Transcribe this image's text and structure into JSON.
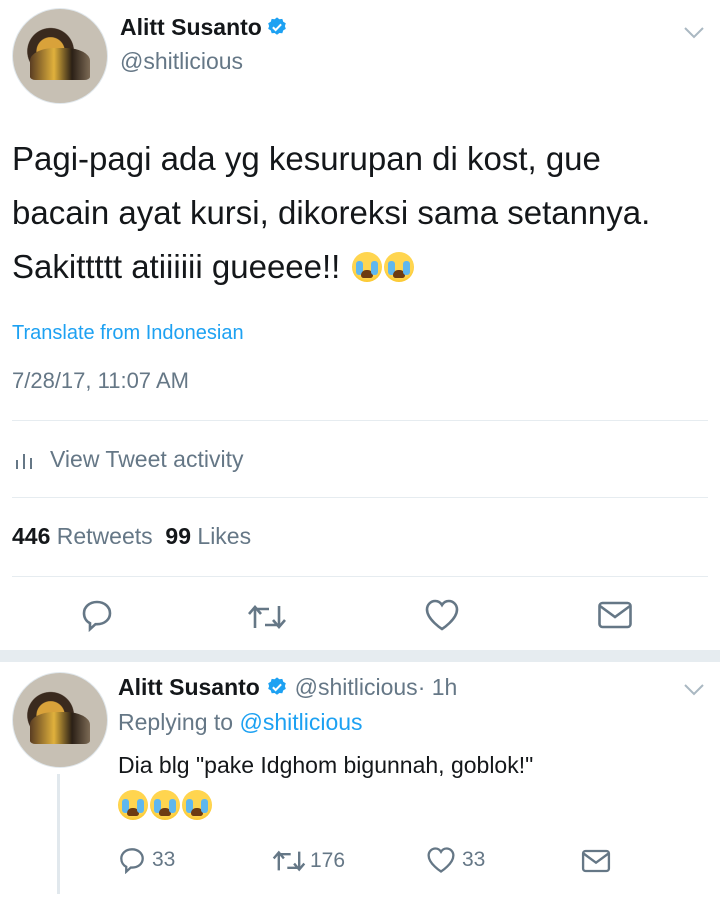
{
  "main_tweet": {
    "author_name": "Alitt Susanto",
    "author_handle": "@shitlicious",
    "text": "Pagi-pagi ada yg kesurupan di kost, gue bacain ayat kursi, dikoreksi sama setannya. Sakittttt atiiiiii gueeee!!",
    "emoji": [
      "loudly-crying-face",
      "loudly-crying-face"
    ],
    "translate_label": "Translate from Indonesian",
    "timestamp": "7/28/17, 11:07 AM",
    "activity_label": "View Tweet activity",
    "retweets_count": "446",
    "retweets_label": "Retweets",
    "likes_count": "99",
    "likes_label": "Likes"
  },
  "reply_tweet": {
    "author_name": "Alitt Susanto",
    "author_handle": "@shitlicious",
    "time": "· 1h",
    "replying_prefix": "Replying to",
    "replying_to": "@shitlicious",
    "text": "Dia blg \"pake Idghom bigunnah, goblok!\"",
    "emoji": [
      "loudly-crying-face",
      "loudly-crying-face",
      "loudly-crying-face"
    ],
    "reply_count": "33",
    "retweet_count": "176",
    "like_count": "33"
  },
  "colors": {
    "accent": "#1da1f2",
    "text": "#14171a",
    "muted": "#657786",
    "divider": "#e6ecf0"
  },
  "icons": [
    "verified-badge-icon",
    "chevron-down-icon",
    "bar-chart-icon",
    "reply-icon",
    "retweet-icon",
    "heart-icon",
    "message-icon"
  ]
}
